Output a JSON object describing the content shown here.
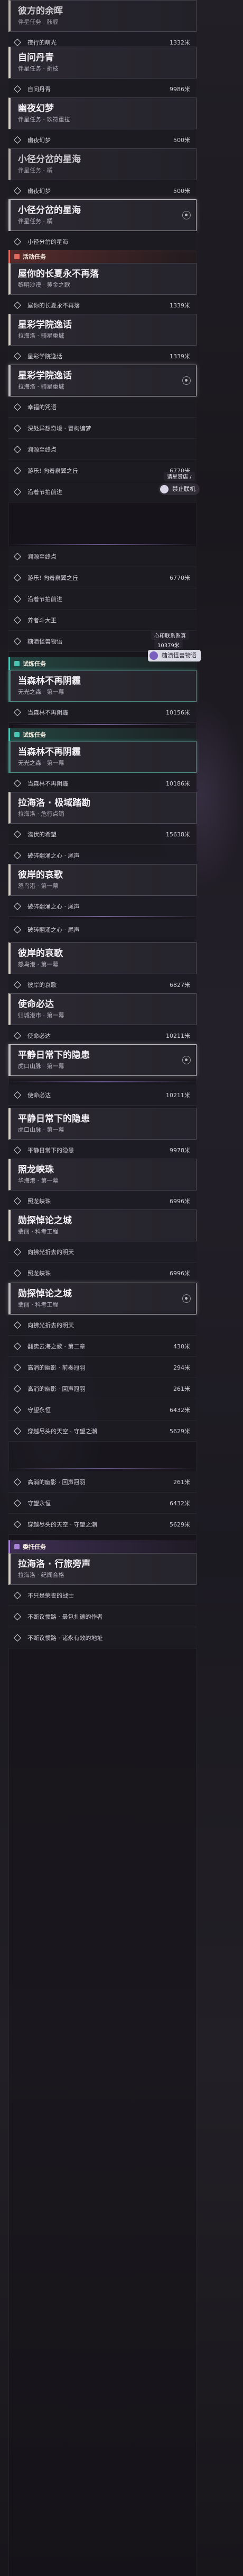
{
  "categories": {
    "activity": "活动任务",
    "commission": "委托任务",
    "trial": "试炼任务",
    "companion": "同行任务"
  },
  "quests": {
    "q_top_1": {
      "title": "彼方的余晖",
      "sub": "伴星任务 · 骸舰"
    },
    "q_top_1_goal": {
      "text": "夜行的萌光",
      "dist": "1332米"
    },
    "q_top_2": {
      "title": "自问丹青",
      "sub": "伴星任务 · 折枝"
    },
    "q_top_2_goal": {
      "text": "自问丹青",
      "dist": "9986米"
    },
    "q_top_3": {
      "title": "幽夜幻梦",
      "sub": "伴星任务 · 玖符重拉"
    },
    "q_top_3_goal": {
      "text": "幽夜幻梦",
      "dist": "500米"
    },
    "q_top_4": {
      "title": "小径分岔的星海",
      "sub": "伴星任务 · 橘"
    },
    "q_top_4_goal": {
      "text": "幽夜幻梦",
      "dist": "500米"
    },
    "q_top_5": {
      "title": "小径分岔的星海",
      "sub": "伴星任务 · 橘"
    },
    "q_top_5_goal": {
      "text": "小径分岔的星海",
      "dist": ""
    },
    "q_act_1": {
      "title": "屋你的长夏永不再落",
      "sub": "黎明沙漠 · 黄金之歌"
    },
    "q_act_1_goal": {
      "text": "屋你的长夏永不再落",
      "dist": "1339米"
    },
    "q_act_2": {
      "title": "星彩学院逸话",
      "sub": "拉海洛 · 骑星重城"
    },
    "q_act_2_goal": {
      "text": "星彩学院逸话",
      "dist": "1339米"
    },
    "q_act_3": {
      "title": "星彩学院逸话",
      "sub": "拉海洛 · 骑星重城"
    },
    "q_act_3_goals": [
      {
        "text": "幸福的咒语",
        "dist": ""
      },
      {
        "text": "深处异想奇境 · 冒构编梦",
        "dist": ""
      },
      {
        "text": "溯源至终点",
        "dist": ""
      },
      {
        "text": "游乐! 向着泉翼之丘",
        "dist": "6770米"
      },
      {
        "text": "沿着节拍前进",
        "dist": ""
      },
      {
        "text": "溯源至终点",
        "dist": ""
      },
      {
        "text": "游乐! 向着泉翼之丘",
        "dist": "6770米"
      },
      {
        "text": "沿着节拍前进",
        "dist": ""
      },
      {
        "text": "养者斗大王",
        "dist": ""
      },
      {
        "text": "糖渍怪兽物语",
        "dist": ""
      }
    ],
    "q_trial_1": {
      "title": "当森林不再阴霾",
      "sub": "无光之森 · 第一幕"
    },
    "q_trial_1_goal": {
      "text": "当森林不再阴霾",
      "dist": "10156米"
    },
    "q_trial_2": {
      "title": "当森林不再阴霾",
      "sub": "无光之森 · 第一幕"
    },
    "q_trial_2_goal": {
      "text": "当森林不再阴霾",
      "dist": "10186米"
    },
    "q_trial_3": {
      "title": "拉海洛 · 极域踏勘",
      "sub": "拉海洛 · 危行点销"
    },
    "q_trial_3_goals": [
      {
        "text": "潜伏的希望",
        "dist": "15638米"
      },
      {
        "text": "破碎翻涌之心 · 尾声",
        "dist": ""
      }
    ],
    "q_trial_4": {
      "title": "彼岸的哀歌",
      "sub": "怒鸟港 · 第一幕"
    },
    "q_trial_4_goals": [
      {
        "text": "破碎翻涌之心 · 尾声",
        "dist": ""
      }
    ],
    "q_trial_5": {
      "title": "彼岸的哀歌",
      "sub": "怒鸟港 · 第一幕"
    },
    "q_trial_5_goal": {
      "text": "彼岸的哀歌",
      "dist": "6827米"
    },
    "q_trial_6": {
      "title": "使命必达",
      "sub": "归城港市 · 第一幕"
    },
    "q_trial_6_goal": {
      "text": "使命必达",
      "dist": "10211米"
    },
    "q_trial_7": {
      "title": "平静日常下的隐患",
      "sub": "虎口山脉 · 第一幕"
    },
    "q_trial_7_goal": {
      "text": "使命必达",
      "dist": "10211米"
    },
    "q_trial_8": {
      "title": "平静日常下的隐患",
      "sub": "虎口山脉 · 第一幕"
    },
    "q_trial_8_goal": {
      "text": "平静日常下的隐患",
      "dist": "9978米"
    },
    "q_trial_9": {
      "title": "照龙峡珠",
      "sub": "华海港 · 第一幕"
    },
    "q_trial_9_goal": {
      "text": "照龙峡珠",
      "dist": "6996米"
    },
    "q_trial_10": {
      "title": "勋探悼论之城",
      "sub": "翡丽 · 科考工程"
    },
    "q_trial_10_goal": {
      "text": "向拂光折去的明天",
      "dist": ""
    },
    "q_trial_10_goal2": {
      "text": "照龙峡珠",
      "dist": "6996米"
    },
    "q_trial_11": {
      "title": "勋探悼论之城",
      "sub": "翡丽 · 科考工程"
    },
    "q_trial_11_goals": [
      {
        "text": "向拂光折去的明天",
        "dist": ""
      },
      {
        "text": "翻卖云海之歌 · 第二章",
        "dist": "430米"
      },
      {
        "text": "高消的幽影 · 前奏冠羽",
        "dist": "294米"
      },
      {
        "text": "高消的幽影 · 回声冠羽",
        "dist": "261米"
      },
      {
        "text": "守望永恒",
        "dist": "6432米"
      },
      {
        "text": "穿越尽头的天空 · 守望之潮",
        "dist": "5629米"
      }
    ],
    "q_trial_12_goals": [
      {
        "text": "高消的幽影 · 回声冠羽",
        "dist": "261米"
      },
      {
        "text": "守望永恒",
        "dist": "6432米"
      },
      {
        "text": "穿越尽头的天空 · 守望之潮",
        "dist": "5629米"
      }
    ],
    "q_comp_1": {
      "title": "拉海洛 · 行旅旁声",
      "sub": "拉海洛 · 纪闻合格"
    },
    "q_comp_1_goals": [
      {
        "text": "不只是荣誉的战士",
        "dist": ""
      },
      {
        "text": "不断议惯路 · 最包扎德的作者",
        "dist": ""
      },
      {
        "text": "不断议惯路 · 诸永有效的地址",
        "dist": ""
      }
    ]
  },
  "side": {
    "chip1": "禁止联机",
    "chip1_prefix": "请星赏店 /",
    "chip2_top": "心印联系系真",
    "chip2_code": "10379米",
    "chip3": "糖渍怪兽物语"
  },
  "colors": {
    "accent_gold": "#d8a34a",
    "accent_teal": "#49c4b2",
    "accent_red": "#e06a5e",
    "accent_purple": "#a882d8"
  }
}
